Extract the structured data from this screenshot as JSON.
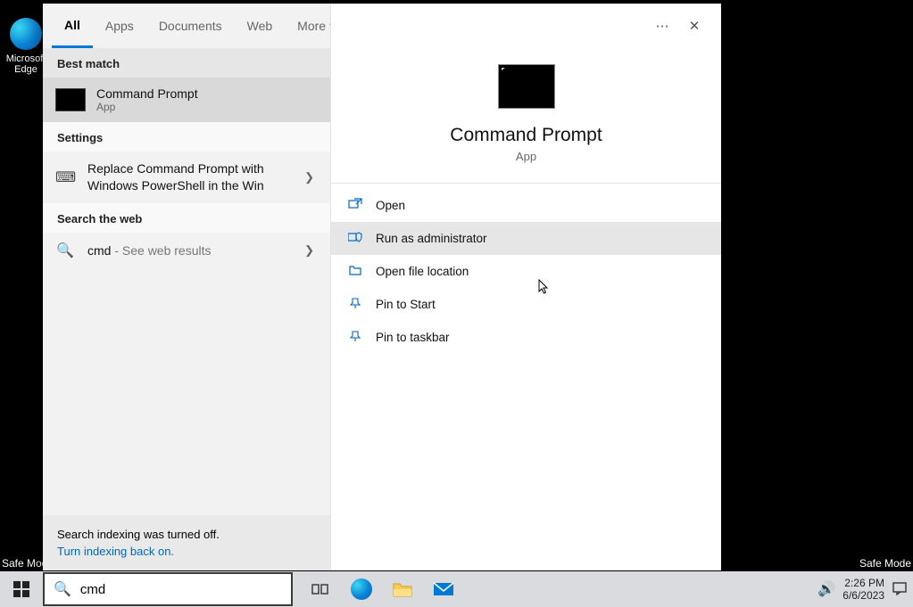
{
  "desktop": {
    "edge_label": "Microsoft Edge",
    "safe_mode_left": "Safe Mode",
    "safe_mode_right": "Safe Mode"
  },
  "tabs": {
    "all": "All",
    "apps": "Apps",
    "documents": "Documents",
    "web": "Web",
    "more": "More"
  },
  "sections": {
    "best_match": "Best match",
    "settings": "Settings",
    "search_web": "Search the web"
  },
  "best_match": {
    "title": "Command Prompt",
    "subtitle": "App"
  },
  "settings_item": {
    "line1": "Replace Command Prompt with",
    "line2": "Windows PowerShell in the Win"
  },
  "web_item": {
    "query": "cmd",
    "suffix": " - See web results"
  },
  "indexing": {
    "status": "Search indexing was turned off.",
    "link": "Turn indexing back on."
  },
  "preview": {
    "title": "Command Prompt",
    "subtitle": "App"
  },
  "actions": {
    "open": "Open",
    "run_admin": "Run as administrator",
    "open_file_location": "Open file location",
    "pin_start": "Pin to Start",
    "pin_taskbar": "Pin to taskbar"
  },
  "taskbar": {
    "search_value": "cmd",
    "time": "2:26 PM",
    "date": "6/6/2023"
  }
}
